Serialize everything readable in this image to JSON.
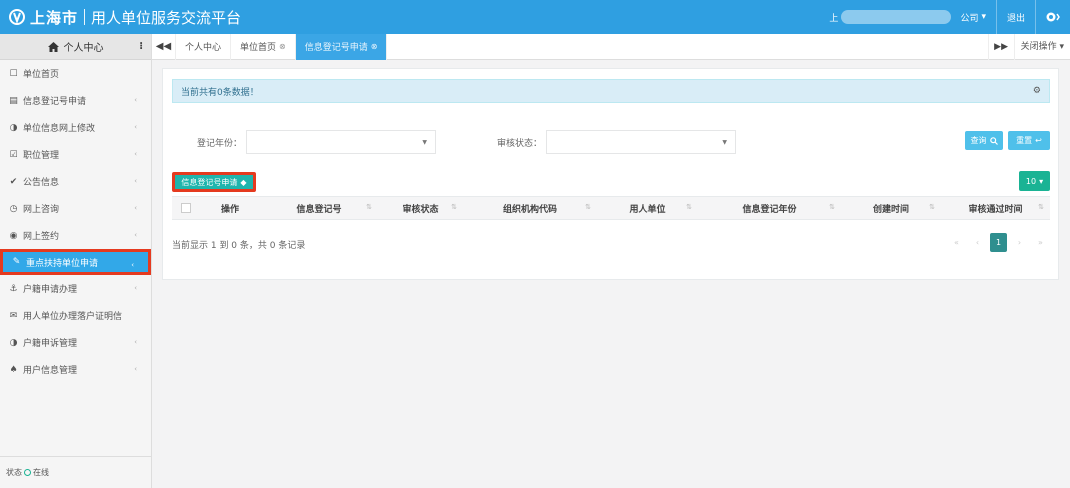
{
  "header": {
    "logo_text": "上海市",
    "platform_title": "用人单位服务交流平台",
    "user_prefix": "上",
    "company_suffix": "公司",
    "logout_label": "退出"
  },
  "sidebar": {
    "title": "个人中心",
    "items": [
      {
        "label": "单位首页",
        "icon": "square-icon",
        "arrow": false
      },
      {
        "label": "信息登记号申请",
        "icon": "document-icon",
        "arrow": true
      },
      {
        "label": "单位信息网上修改",
        "icon": "circle-half-icon",
        "arrow": true
      },
      {
        "label": "职位管理",
        "icon": "checkbox-icon",
        "arrow": true
      },
      {
        "label": "公告信息",
        "icon": "check-icon",
        "arrow": true
      },
      {
        "label": "网上咨询",
        "icon": "clock-icon",
        "arrow": true
      },
      {
        "label": "网上签约",
        "icon": "eye-icon",
        "arrow": true
      },
      {
        "label": "重点扶持单位申请",
        "icon": "pencil-icon",
        "arrow": true,
        "active": true
      },
      {
        "label": "户籍申请办理",
        "icon": "anchor-icon",
        "arrow": true
      },
      {
        "label": "用人单位办理落户证明信",
        "icon": "envelope-icon",
        "arrow": false
      },
      {
        "label": "户籍申诉管理",
        "icon": "circle-half-icon",
        "arrow": true
      },
      {
        "label": "用户信息管理",
        "icon": "bell-icon",
        "arrow": true
      }
    ],
    "status_label": "状态",
    "status_value": "在线"
  },
  "tabs": {
    "items": [
      {
        "label": "个人中心",
        "closable": false
      },
      {
        "label": "单位首页",
        "closable": true
      },
      {
        "label": "信息登记号申请",
        "closable": true,
        "active": true
      }
    ],
    "close_ops": "关闭操作"
  },
  "content": {
    "alert_text": "当前共有0条数据！",
    "filters": {
      "year_label": "登记年份：",
      "status_label": "审核状态："
    },
    "search_label": "查询",
    "reset_label": "重置",
    "apply_button": "信息登记号申请",
    "page_size": "10",
    "columns": [
      "操作",
      "信息登记号",
      "审核状态",
      "组织机构代码",
      "用人单位",
      "信息登记年份",
      "创建时间",
      "审核通过时间"
    ],
    "summary": "当前显示 1 到 0 条，共 0 条记录",
    "current_page": "1"
  }
}
